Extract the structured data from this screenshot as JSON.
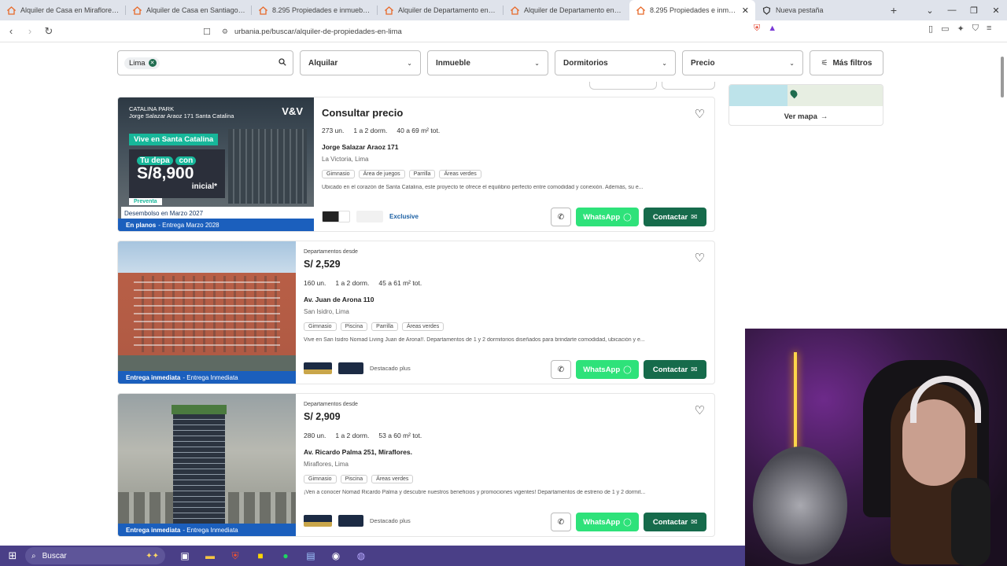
{
  "browser": {
    "tabs": [
      {
        "title": "Alquiler de Casa en Miraflores - Lim",
        "active": false
      },
      {
        "title": "Alquiler de Casa en Santiago de Sur",
        "active": false
      },
      {
        "title": "8.295 Propiedades e inmuebles en a",
        "active": false
      },
      {
        "title": "Alquiler de Departamento en Mirafl",
        "active": false
      },
      {
        "title": "Alquiler de Departamento en Jesús",
        "active": false
      },
      {
        "title": "8.295 Propiedades e inmuebles",
        "active": true
      },
      {
        "title": "Nueva pestaña",
        "active": false
      }
    ],
    "url": "urbania.pe/buscar/alquiler-de-propiedades-en-lima"
  },
  "filters": {
    "search_chip": "Lima",
    "dropdowns": [
      "Alquilar",
      "Inmueble",
      "Dormitorios",
      "Precio"
    ],
    "more_filters": "Más filtros"
  },
  "map": {
    "link": "Ver mapa"
  },
  "listings": [
    {
      "price_label": "",
      "price": "Consultar precio",
      "units": "273 un.",
      "bedrooms": "1 a 2 dorm.",
      "area": "40 a 69 m² tot.",
      "address": "Jorge Salazar Araoz 171",
      "location": "La Victoria, Lima",
      "tags": [
        "Gimnasio",
        "Área de juegos",
        "Parrilla",
        "Áreas verdes"
      ],
      "description": "Ubicado en el corazón de Santa Catalina, este proyecto te ofrece el equilibrio perfecto entre comodidad y conexión. Además, su e...",
      "badge": "Exclusive",
      "banner_bold": "En planos",
      "banner_text": "- Entrega Marzo 2028",
      "promo": {
        "brand": "CATALINA PARK",
        "project": "Jorge Salazar Araoz 171 Santa Catalina",
        "developer": "V&V",
        "vive": "Vive en Santa Catalina",
        "tudepa": "Tu depa",
        "con": "con",
        "amount": "S/8,900",
        "inicial": "inicial*",
        "preventa": "Preventa",
        "desembolso": "Desembolso en Marzo 2027"
      }
    },
    {
      "price_label": "Departamentos desde",
      "price": "S/ 2,529",
      "units": "160 un.",
      "bedrooms": "1 a 2 dorm.",
      "area": "45 a 61 m² tot.",
      "address": "Av. Juan de Arona 110",
      "location": "San Isidro, Lima",
      "tags": [
        "Gimnasio",
        "Piscina",
        "Parrilla",
        "Áreas verdes"
      ],
      "description": "Vive en San Isidro Nomad Living Juan de Arona!!. Departamentos de 1 y 2 dormitorios diseñados para brindarte comodidad, ubicación y e...",
      "badge": "Destacado plus",
      "banner_bold": "Entrega inmediata",
      "banner_text": "- Entrega Inmediata"
    },
    {
      "price_label": "Departamentos desde",
      "price": "S/ 2,909",
      "units": "280 un.",
      "bedrooms": "1 a 2 dorm.",
      "area": "53 a 60 m² tot.",
      "address": "Av. Ricardo Palma 251, Miraflores.",
      "location": "Miraflores, Lima",
      "tags": [
        "Gimnasio",
        "Piscina",
        "Áreas verdes"
      ],
      "description": "¡Ven a conocer Nomad Ricardo Palma y descubre nuestros beneficios y promociones vigentes! Departamentos de estreno de 1 y 2 dormit...",
      "badge": "Destacado plus",
      "banner_bold": "Entrega inmediata",
      "banner_text": "- Entrega Inmediata"
    }
  ],
  "actions": {
    "whatsapp": "WhatsApp",
    "contact": "Contactar"
  },
  "taskbar": {
    "search": "Buscar"
  },
  "colors": {
    "brand_green": "#166b4b",
    "whatsapp": "#2ee27a",
    "banner_blue": "#1b5fbd",
    "taskbar": "#4a3f87"
  }
}
